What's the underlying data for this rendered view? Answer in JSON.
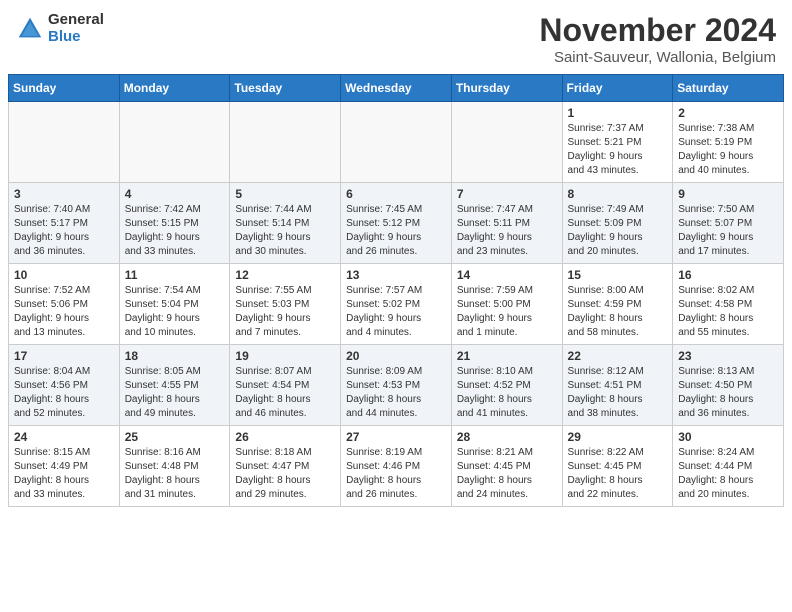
{
  "logo": {
    "general": "General",
    "blue": "Blue"
  },
  "header": {
    "title": "November 2024",
    "subtitle": "Saint-Sauveur, Wallonia, Belgium"
  },
  "weekdays": [
    "Sunday",
    "Monday",
    "Tuesday",
    "Wednesday",
    "Thursday",
    "Friday",
    "Saturday"
  ],
  "weeks": [
    [
      {
        "day": "",
        "info": ""
      },
      {
        "day": "",
        "info": ""
      },
      {
        "day": "",
        "info": ""
      },
      {
        "day": "",
        "info": ""
      },
      {
        "day": "",
        "info": ""
      },
      {
        "day": "1",
        "info": "Sunrise: 7:37 AM\nSunset: 5:21 PM\nDaylight: 9 hours\nand 43 minutes."
      },
      {
        "day": "2",
        "info": "Sunrise: 7:38 AM\nSunset: 5:19 PM\nDaylight: 9 hours\nand 40 minutes."
      }
    ],
    [
      {
        "day": "3",
        "info": "Sunrise: 7:40 AM\nSunset: 5:17 PM\nDaylight: 9 hours\nand 36 minutes."
      },
      {
        "day": "4",
        "info": "Sunrise: 7:42 AM\nSunset: 5:15 PM\nDaylight: 9 hours\nand 33 minutes."
      },
      {
        "day": "5",
        "info": "Sunrise: 7:44 AM\nSunset: 5:14 PM\nDaylight: 9 hours\nand 30 minutes."
      },
      {
        "day": "6",
        "info": "Sunrise: 7:45 AM\nSunset: 5:12 PM\nDaylight: 9 hours\nand 26 minutes."
      },
      {
        "day": "7",
        "info": "Sunrise: 7:47 AM\nSunset: 5:11 PM\nDaylight: 9 hours\nand 23 minutes."
      },
      {
        "day": "8",
        "info": "Sunrise: 7:49 AM\nSunset: 5:09 PM\nDaylight: 9 hours\nand 20 minutes."
      },
      {
        "day": "9",
        "info": "Sunrise: 7:50 AM\nSunset: 5:07 PM\nDaylight: 9 hours\nand 17 minutes."
      }
    ],
    [
      {
        "day": "10",
        "info": "Sunrise: 7:52 AM\nSunset: 5:06 PM\nDaylight: 9 hours\nand 13 minutes."
      },
      {
        "day": "11",
        "info": "Sunrise: 7:54 AM\nSunset: 5:04 PM\nDaylight: 9 hours\nand 10 minutes."
      },
      {
        "day": "12",
        "info": "Sunrise: 7:55 AM\nSunset: 5:03 PM\nDaylight: 9 hours\nand 7 minutes."
      },
      {
        "day": "13",
        "info": "Sunrise: 7:57 AM\nSunset: 5:02 PM\nDaylight: 9 hours\nand 4 minutes."
      },
      {
        "day": "14",
        "info": "Sunrise: 7:59 AM\nSunset: 5:00 PM\nDaylight: 9 hours\nand 1 minute."
      },
      {
        "day": "15",
        "info": "Sunrise: 8:00 AM\nSunset: 4:59 PM\nDaylight: 8 hours\nand 58 minutes."
      },
      {
        "day": "16",
        "info": "Sunrise: 8:02 AM\nSunset: 4:58 PM\nDaylight: 8 hours\nand 55 minutes."
      }
    ],
    [
      {
        "day": "17",
        "info": "Sunrise: 8:04 AM\nSunset: 4:56 PM\nDaylight: 8 hours\nand 52 minutes."
      },
      {
        "day": "18",
        "info": "Sunrise: 8:05 AM\nSunset: 4:55 PM\nDaylight: 8 hours\nand 49 minutes."
      },
      {
        "day": "19",
        "info": "Sunrise: 8:07 AM\nSunset: 4:54 PM\nDaylight: 8 hours\nand 46 minutes."
      },
      {
        "day": "20",
        "info": "Sunrise: 8:09 AM\nSunset: 4:53 PM\nDaylight: 8 hours\nand 44 minutes."
      },
      {
        "day": "21",
        "info": "Sunrise: 8:10 AM\nSunset: 4:52 PM\nDaylight: 8 hours\nand 41 minutes."
      },
      {
        "day": "22",
        "info": "Sunrise: 8:12 AM\nSunset: 4:51 PM\nDaylight: 8 hours\nand 38 minutes."
      },
      {
        "day": "23",
        "info": "Sunrise: 8:13 AM\nSunset: 4:50 PM\nDaylight: 8 hours\nand 36 minutes."
      }
    ],
    [
      {
        "day": "24",
        "info": "Sunrise: 8:15 AM\nSunset: 4:49 PM\nDaylight: 8 hours\nand 33 minutes."
      },
      {
        "day": "25",
        "info": "Sunrise: 8:16 AM\nSunset: 4:48 PM\nDaylight: 8 hours\nand 31 minutes."
      },
      {
        "day": "26",
        "info": "Sunrise: 8:18 AM\nSunset: 4:47 PM\nDaylight: 8 hours\nand 29 minutes."
      },
      {
        "day": "27",
        "info": "Sunrise: 8:19 AM\nSunset: 4:46 PM\nDaylight: 8 hours\nand 26 minutes."
      },
      {
        "day": "28",
        "info": "Sunrise: 8:21 AM\nSunset: 4:45 PM\nDaylight: 8 hours\nand 24 minutes."
      },
      {
        "day": "29",
        "info": "Sunrise: 8:22 AM\nSunset: 4:45 PM\nDaylight: 8 hours\nand 22 minutes."
      },
      {
        "day": "30",
        "info": "Sunrise: 8:24 AM\nSunset: 4:44 PM\nDaylight: 8 hours\nand 20 minutes."
      }
    ]
  ]
}
